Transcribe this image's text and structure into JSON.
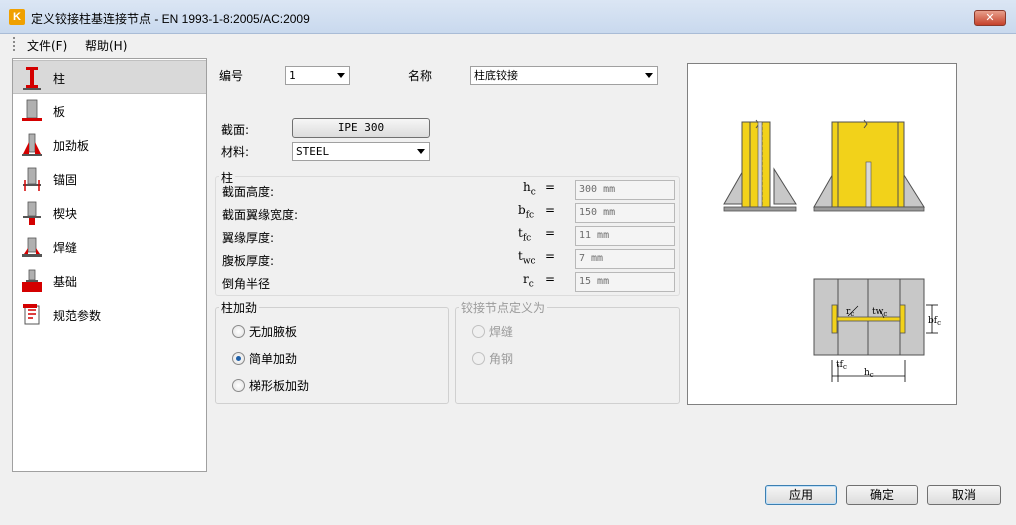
{
  "window": {
    "title": "定义铰接柱基连接节点 - EN 1993-1-8:2005/AC:2009",
    "app_icon": "K",
    "close_glyph": "✕"
  },
  "menu": {
    "file": "文件(F)",
    "help": "帮助(H)"
  },
  "nav": {
    "items": [
      {
        "label": "柱",
        "icon": "column-icon",
        "selected": true
      },
      {
        "label": "板",
        "icon": "plate-icon"
      },
      {
        "label": "加劲板",
        "icon": "stiffener-icon"
      },
      {
        "label": "锚固",
        "icon": "anchor-icon"
      },
      {
        "label": "楔块",
        "icon": "shear-key-icon"
      },
      {
        "label": "焊缝",
        "icon": "weld-icon"
      },
      {
        "label": "基础",
        "icon": "foundation-icon"
      },
      {
        "label": "规范参数",
        "icon": "code-parameters-icon"
      }
    ]
  },
  "header": {
    "number_label": "编号",
    "number_value": "1",
    "name_label": "名称",
    "name_value": "柱底铰接"
  },
  "section": {
    "label": "截面:",
    "value": "IPE 300",
    "material_label": "材料:",
    "material_value": "STEEL"
  },
  "column_props": {
    "group_title": "柱",
    "rows": [
      {
        "label": "截面高度:",
        "sym": "h",
        "sub": "c",
        "value": "300 mm"
      },
      {
        "label": "截面翼缘宽度:",
        "sym": "b",
        "sub": "fc",
        "value": "150 mm"
      },
      {
        "label": "翼缘厚度:",
        "sym": "t",
        "sub": "fc",
        "value": "11 mm"
      },
      {
        "label": "腹板厚度:",
        "sym": "t",
        "sub": "wc",
        "value": "7 mm"
      },
      {
        "label": "倒角半径",
        "sym": "r",
        "sub": "c",
        "value": "15 mm"
      }
    ],
    "equals": "="
  },
  "stiffening": {
    "group_title": "柱加劲",
    "options": [
      {
        "label": "无加腋板",
        "checked": false
      },
      {
        "label": "简单加劲",
        "checked": true
      },
      {
        "label": "梯形板加劲",
        "checked": false
      }
    ]
  },
  "joint_def": {
    "group_title": "铰接节点定义为",
    "options": [
      {
        "label": "焊缝"
      },
      {
        "label": "角钢"
      }
    ]
  },
  "preview": {
    "labels": {
      "rc": "r",
      "rc_sub": "c",
      "twc": "tw",
      "twc_sub": "c",
      "bfc": "bf",
      "bfc_sub": "c",
      "tfc": "tf",
      "tfc_sub": "c",
      "hc": "h",
      "hc_sub": "c"
    },
    "colors": {
      "yellow": "#f2d21a",
      "grey": "#c8c8c8",
      "dark": "#505050"
    }
  },
  "footer": {
    "apply": "应用",
    "ok": "确定",
    "cancel": "取消"
  }
}
